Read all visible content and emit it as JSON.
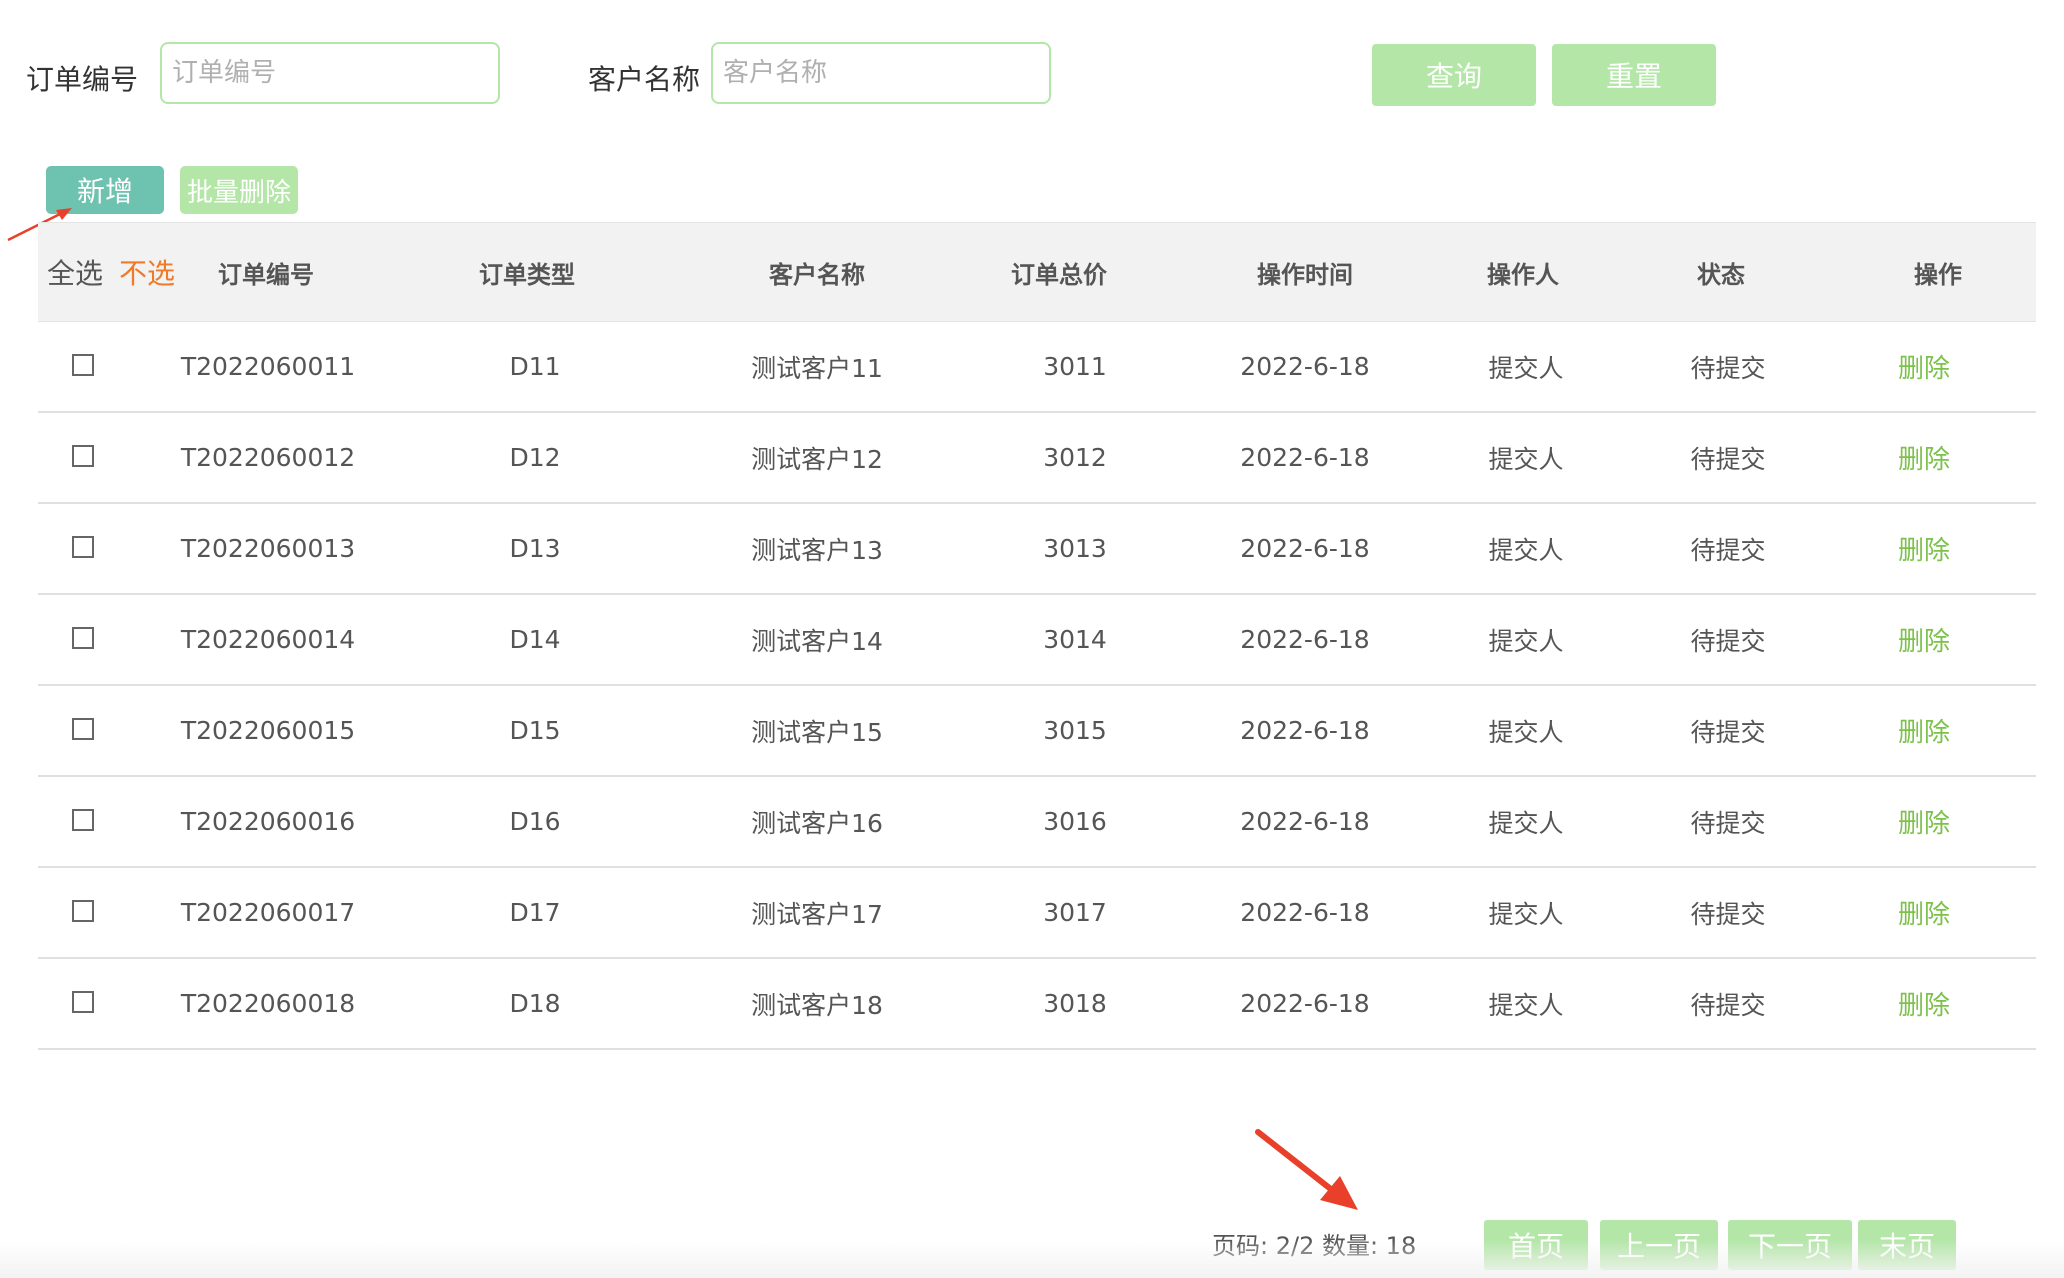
{
  "search": {
    "order_no_label": "订单编号",
    "order_no_placeholder": "订单编号",
    "order_no_value": "",
    "customer_label": "客户名称",
    "customer_placeholder": "客户名称",
    "customer_value": "",
    "query_label": "查询",
    "reset_label": "重置"
  },
  "actions": {
    "add_label": "新增",
    "batch_delete_label": "批量删除"
  },
  "table": {
    "select_all": "全选",
    "select_none": "不选",
    "headers": [
      "订单编号",
      "订单类型",
      "客户名称",
      "订单总价",
      "操作时间",
      "操作人",
      "状态",
      "操作"
    ],
    "rows": [
      {
        "order_no": "T2022060011",
        "type": "D11",
        "customer": "测试客户11",
        "total": "3011",
        "time": "2022-6-18",
        "operator": "提交人",
        "status": "待提交",
        "action": "删除"
      },
      {
        "order_no": "T2022060012",
        "type": "D12",
        "customer": "测试客户12",
        "total": "3012",
        "time": "2022-6-18",
        "operator": "提交人",
        "status": "待提交",
        "action": "删除"
      },
      {
        "order_no": "T2022060013",
        "type": "D13",
        "customer": "测试客户13",
        "total": "3013",
        "time": "2022-6-18",
        "operator": "提交人",
        "status": "待提交",
        "action": "删除"
      },
      {
        "order_no": "T2022060014",
        "type": "D14",
        "customer": "测试客户14",
        "total": "3014",
        "time": "2022-6-18",
        "operator": "提交人",
        "status": "待提交",
        "action": "删除"
      },
      {
        "order_no": "T2022060015",
        "type": "D15",
        "customer": "测试客户15",
        "total": "3015",
        "time": "2022-6-18",
        "operator": "提交人",
        "status": "待提交",
        "action": "删除"
      },
      {
        "order_no": "T2022060016",
        "type": "D16",
        "customer": "测试客户16",
        "total": "3016",
        "time": "2022-6-18",
        "operator": "提交人",
        "status": "待提交",
        "action": "删除"
      },
      {
        "order_no": "T2022060017",
        "type": "D17",
        "customer": "测试客户17",
        "total": "3017",
        "time": "2022-6-18",
        "operator": "提交人",
        "status": "待提交",
        "action": "删除"
      },
      {
        "order_no": "T2022060018",
        "type": "D18",
        "customer": "测试客户18",
        "total": "3018",
        "time": "2022-6-18",
        "operator": "提交人",
        "status": "待提交",
        "action": "删除"
      }
    ]
  },
  "pagination": {
    "info": "页码: 2/2 数量: 18",
    "first": "首页",
    "prev": "上一页",
    "next": "下一页",
    "last": "末页"
  },
  "colors": {
    "primary": "#6ec2b0",
    "light_green": "#b4e6a8",
    "link_green": "#7cc24a",
    "orange": "#f07a2a",
    "annotation_red": "#e8402a"
  },
  "annotations": [
    "arrow-to-add-button",
    "arrow-to-page-info"
  ]
}
